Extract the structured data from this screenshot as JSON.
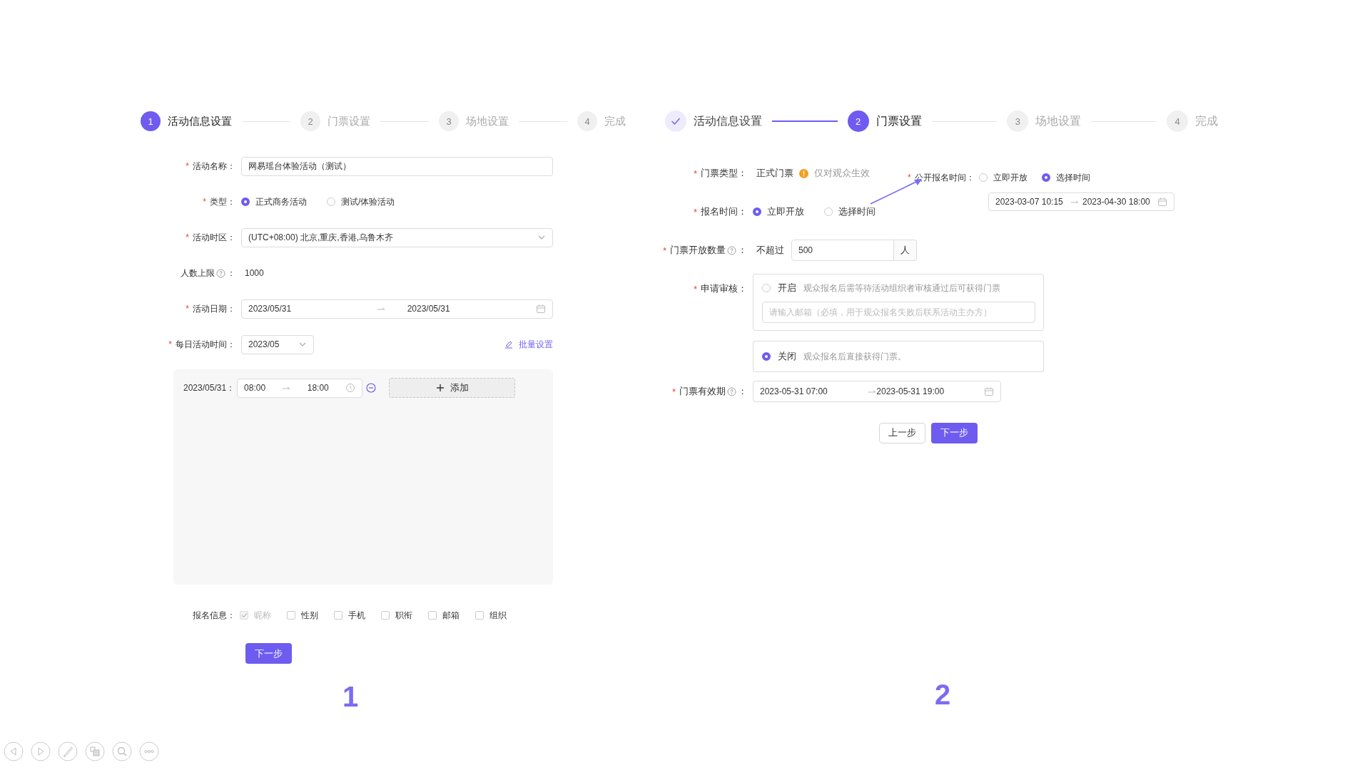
{
  "panel_1": {
    "steps": [
      {
        "number": "1",
        "label": "活动信息设置",
        "selected": true,
        "done": false
      },
      {
        "number": "2",
        "label": "门票设置",
        "selected": false,
        "done": false
      },
      {
        "number": "3",
        "label": "场地设置",
        "selected": false,
        "done": false
      },
      {
        "number": "4",
        "label": "完成",
        "selected": false,
        "done": false
      }
    ],
    "event_name": {
      "asterisk": "*",
      "label": "活动名称：",
      "value": "网易瑶台体验活动（测试）"
    },
    "event_type": {
      "asterisk": "*",
      "label": "类型：",
      "options": [
        {
          "label": "正式商务活动",
          "selected": true
        },
        {
          "label": "测试/体验活动",
          "selected": false
        }
      ]
    },
    "time_zone": {
      "asterisk": "*",
      "label": "活动时区：",
      "value": "(UTC+08:00) 北京,重庆,香港,乌鲁木齐"
    },
    "capacity": {
      "label": "人数上限",
      "colon": "：",
      "value": "1000"
    },
    "event_date": {
      "asterisk": "*",
      "label": "活动日期：",
      "start": "2023/05/31",
      "end": "2023/05/31"
    },
    "daily_time": {
      "asterisk": "*",
      "label": "每日活动时间：",
      "value": "2023/05",
      "batch_link": "批量设置"
    },
    "time_slots": [
      {
        "date": "2023/05/31：",
        "start": "08:00",
        "end": "18:00"
      }
    ],
    "add_button": "添加",
    "signup_info": {
      "label": "报名信息：",
      "options": [
        {
          "label": "昵称",
          "checked": true,
          "disabled": true
        },
        {
          "label": "性别",
          "checked": false,
          "disabled": false
        },
        {
          "label": "手机",
          "checked": false,
          "disabled": false
        },
        {
          "label": "职衔",
          "checked": false,
          "disabled": false
        },
        {
          "label": "邮箱",
          "checked": false,
          "disabled": false
        },
        {
          "label": "组织",
          "checked": false,
          "disabled": false
        }
      ]
    },
    "next_button": "下一步",
    "caption": "1"
  },
  "panel_2": {
    "steps": [
      {
        "label": "活动信息设置",
        "selected": false,
        "done": true
      },
      {
        "number": "2",
        "label": "门票设置",
        "selected": true,
        "done": false
      },
      {
        "number": "3",
        "label": "场地设置",
        "selected": false,
        "done": false
      },
      {
        "number": "4",
        "label": "完成",
        "selected": false,
        "done": false
      }
    ],
    "ticket_type": {
      "asterisk": "*",
      "label": "门票类型：",
      "value": "正式门票",
      "note": "仅对观众生效"
    },
    "signup_time": {
      "asterisk": "*",
      "label": "报名时间：",
      "options": [
        {
          "label": "立即开放",
          "selected": true
        },
        {
          "label": "选择时间",
          "selected": false
        }
      ]
    },
    "public_signup_time": {
      "asterisk": "*",
      "label": "公开报名时间：",
      "options": [
        {
          "label": "立即开放",
          "selected": false
        },
        {
          "label": "选择时间",
          "selected": true
        }
      ],
      "start": "2023-03-07 10:15",
      "end": "2023-04-30 18:00"
    },
    "quantity": {
      "asterisk": "*",
      "label": "门票开放数量",
      "colon": "：",
      "prefix": "不超过",
      "value": "500",
      "unit": "人"
    },
    "review": {
      "asterisk": "*",
      "label": "申请审核：",
      "options": [
        {
          "label": "开启",
          "description": "观众报名后需等待活动组织者审核通过后可获得门票",
          "selected": false,
          "placeholder": "请输入邮箱（必填，用于观众报名失败后联系活动主办方）"
        },
        {
          "label": "关闭",
          "description": "观众报名后直接获得门票。",
          "selected": true
        }
      ]
    },
    "validity": {
      "asterisk": "*",
      "label": "门票有效期",
      "colon": "：",
      "start": "2023-05-31 07:00",
      "end": "2023-05-31 19:00"
    },
    "prev_button": "上一步",
    "next_button": "下一步",
    "caption": "2"
  }
}
